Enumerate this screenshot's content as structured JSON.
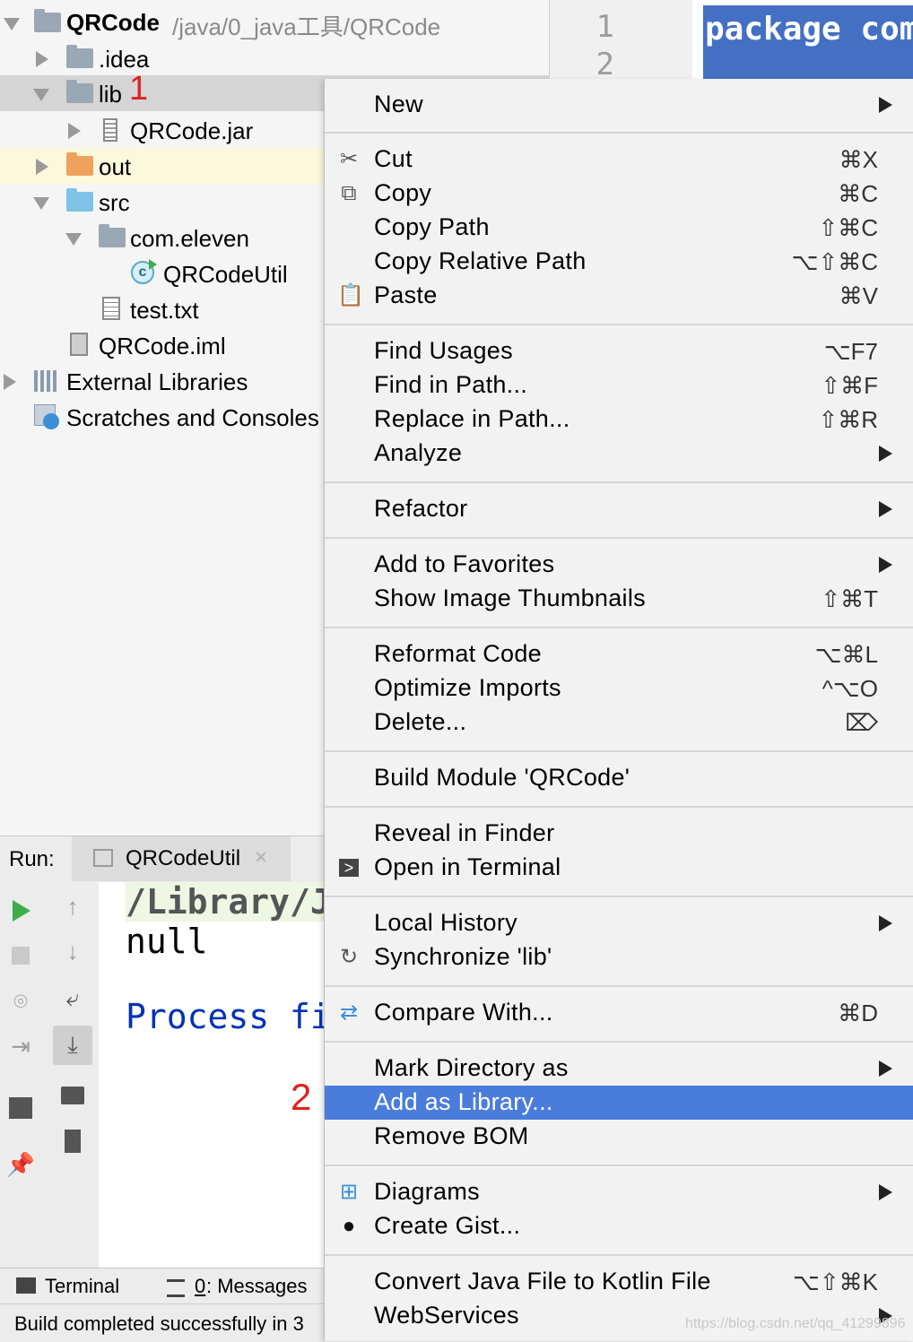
{
  "project_tree": {
    "root": {
      "name": "QRCode",
      "path": "/java/0_java工具/QRCode"
    },
    "items": [
      {
        "label": ".idea"
      },
      {
        "label": "lib",
        "marker": "1"
      },
      {
        "label": "QRCode.jar"
      },
      {
        "label": "out"
      },
      {
        "label": "src"
      },
      {
        "label": "com.eleven"
      },
      {
        "label": "QRCodeUtil"
      },
      {
        "label": "test.txt"
      },
      {
        "label": "QRCode.iml"
      },
      {
        "label": "External Libraries"
      },
      {
        "label": "Scratches and Consoles"
      }
    ]
  },
  "editor": {
    "line_numbers": [
      "1",
      "2"
    ],
    "code_line": "package com"
  },
  "run_panel": {
    "label": "Run:",
    "tab_label": "QRCodeUtil",
    "console_lines": [
      "/Library/J",
      "null",
      "Process fi"
    ],
    "marker": "2"
  },
  "bottom_tabs": {
    "terminal": "Terminal",
    "messages_key": "0",
    "messages": ": Messages"
  },
  "status_bar": {
    "text": "Build completed successfully in 3"
  },
  "context_menu": {
    "items": [
      {
        "label": "New",
        "submenu": true
      },
      {
        "label": "Cut",
        "shortcut": "⌘X",
        "icon": "scissors-icon"
      },
      {
        "label": "Copy",
        "shortcut": "⌘C",
        "icon": "copy-icon"
      },
      {
        "label": "Copy Path",
        "shortcut": "⇧⌘C"
      },
      {
        "label": "Copy Relative Path",
        "shortcut": "⌥⇧⌘C"
      },
      {
        "label": "Paste",
        "shortcut": "⌘V",
        "icon": "clipboard-icon"
      },
      {
        "label": "Find Usages",
        "shortcut": "⌥F7"
      },
      {
        "label": "Find in Path...",
        "shortcut": "⇧⌘F"
      },
      {
        "label": "Replace in Path...",
        "shortcut": "⇧⌘R"
      },
      {
        "label": "Analyze",
        "submenu": true
      },
      {
        "label": "Refactor",
        "submenu": true
      },
      {
        "label": "Add to Favorites",
        "submenu": true
      },
      {
        "label": "Show Image Thumbnails",
        "shortcut": "⇧⌘T"
      },
      {
        "label": "Reformat Code",
        "shortcut": "⌥⌘L"
      },
      {
        "label": "Optimize Imports",
        "shortcut": "^⌥O"
      },
      {
        "label": "Delete...",
        "shortcut": "⌦"
      },
      {
        "label": "Build Module 'QRCode'"
      },
      {
        "label": "Reveal in Finder"
      },
      {
        "label": "Open in Terminal",
        "icon": "terminal-icon"
      },
      {
        "label": "Local History",
        "submenu": true
      },
      {
        "label": "Synchronize 'lib'",
        "icon": "sync-icon"
      },
      {
        "label": "Compare With...",
        "shortcut": "⌘D",
        "icon": "compare-icon"
      },
      {
        "label": "Mark Directory as",
        "submenu": true
      },
      {
        "label": "Add as Library...",
        "selected": true
      },
      {
        "label": "Remove BOM"
      },
      {
        "label": "Diagrams",
        "submenu": true,
        "icon": "diagram-icon"
      },
      {
        "label": "Create Gist...",
        "icon": "github-icon"
      },
      {
        "label": "Convert Java File to Kotlin File",
        "shortcut": "⌥⇧⌘K"
      },
      {
        "label": "WebServices",
        "submenu": true
      }
    ]
  },
  "watermark": "https://blog.csdn.net/qq_41299896",
  "colors": {
    "selection": "#4a7ddb",
    "marker_red": "#e02020",
    "code_highlight": "#4470c4",
    "keyword": "#0033b3"
  }
}
